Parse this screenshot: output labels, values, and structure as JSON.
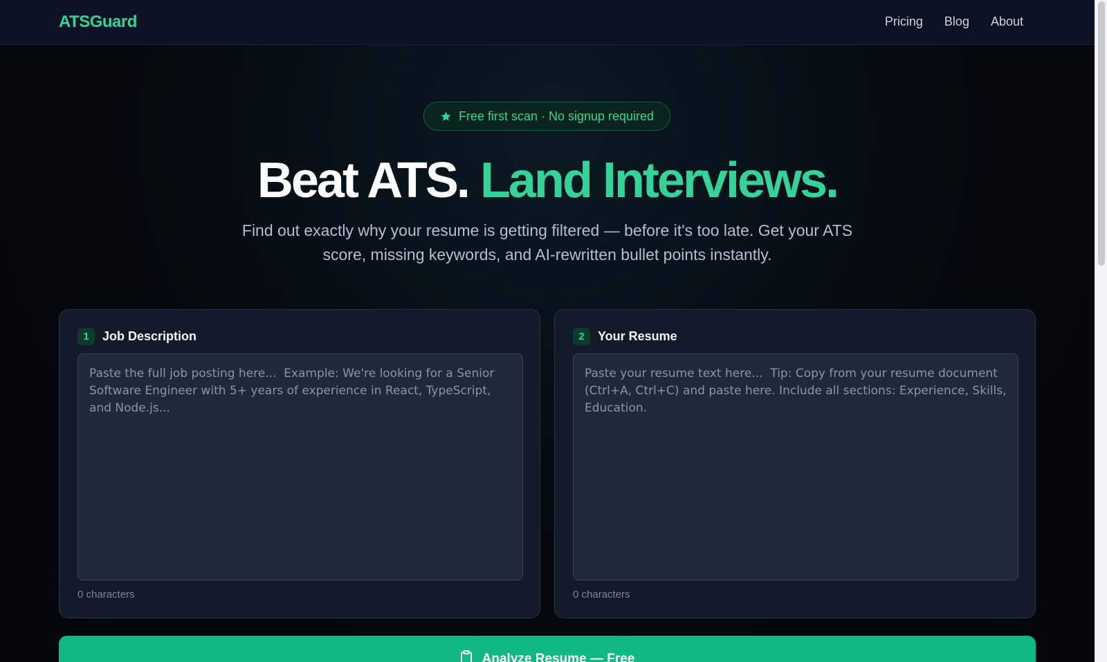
{
  "nav": {
    "logo": "ATSGuard",
    "links": [
      "Pricing",
      "Blog",
      "About"
    ]
  },
  "hero": {
    "badge": "Free first scan · No signup required",
    "title_main": "Beat ATS.",
    "title_accent": "Land Interviews.",
    "subtitle": "Find out exactly why your resume is getting filtered — before it's too late. Get your ATS score, missing keywords, and AI-rewritten bullet points instantly."
  },
  "cards": {
    "job": {
      "step": "1",
      "title": "Job Description",
      "placeholder": "Paste the full job posting here...  Example: We're looking for a Senior Software Engineer with 5+ years of experience in React, TypeScript, and Node.js...",
      "value": "",
      "char_count": "0 characters"
    },
    "resume": {
      "step": "2",
      "title": "Your Resume",
      "placeholder": "Paste your resume text here...  Tip: Copy from your resume document (Ctrl+A, Ctrl+C) and paste here. Include all sections: Experience, Skills, Education.",
      "value": "",
      "char_count": "0 characters"
    }
  },
  "analyze": {
    "label": "Analyze Resume — Free",
    "icon": "clipboard-icon"
  },
  "colors": {
    "accent": "#34d399",
    "button": "#10b981",
    "background": "#05080f",
    "card": "#131b2b"
  }
}
